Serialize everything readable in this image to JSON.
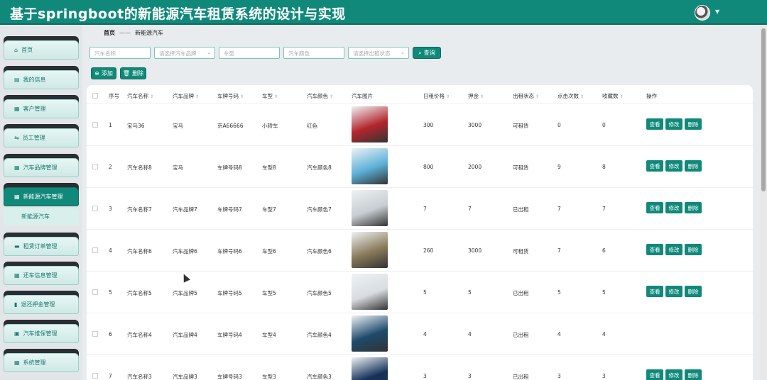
{
  "header": {
    "title": "基于springboot的新能源汽车租赁系统的设计与实现"
  },
  "sidebar": {
    "items": [
      {
        "label": "首页",
        "icon": "home-icon"
      },
      {
        "label": "我的信息",
        "icon": "calendar-icon"
      },
      {
        "label": "客户管理",
        "icon": "grid-icon"
      },
      {
        "label": "员工管理",
        "icon": "sliders-icon"
      },
      {
        "label": "汽车品牌管理",
        "icon": "grid-icon"
      },
      {
        "label": "新能源汽车管理",
        "icon": "grid-icon",
        "active": true
      },
      {
        "label": "租赁订单管理",
        "icon": "monitor-icon"
      },
      {
        "label": "还车信息管理",
        "icon": "grid-icon"
      },
      {
        "label": "退还押金管理",
        "icon": "bar-chart-icon"
      },
      {
        "label": "汽车维保管理",
        "icon": "clipboard-icon"
      },
      {
        "label": "系统管理",
        "icon": "grid-icon"
      }
    ],
    "submenu": "新能源汽车"
  },
  "breadcrumb": {
    "home": "首页",
    "sep": "——",
    "current": "新能源汽车"
  },
  "search": {
    "car_name": "汽车名称",
    "brand": "请选择汽车品牌",
    "model": "车型",
    "color": "汽车颜色",
    "status": "请选择出租状态",
    "query": "查询"
  },
  "toolbar": {
    "add": "添加",
    "delete": "删除"
  },
  "table": {
    "headers": [
      "序号",
      "汽车名称",
      "汽车品牌",
      "车牌号码",
      "车型",
      "汽车颜色",
      "汽车图片",
      "日租价格",
      "押金",
      "出租状态",
      "点击次数",
      "收藏数",
      "操作"
    ],
    "rows": [
      {
        "no": "1",
        "name": "宝马36",
        "brand": "宝马",
        "plate": "京A66666",
        "model": "小轿车",
        "color": "红色",
        "price": "300",
        "deposit": "3000",
        "status": "可租赁",
        "clicks": "0",
        "favs": "0",
        "imgcolor": "#b3262c",
        "actions": true
      },
      {
        "no": "2",
        "name": "汽车名称8",
        "brand": "宝马",
        "plate": "车牌号码8",
        "model": "车型8",
        "color": "汽车颜色8",
        "price": "800",
        "deposit": "2000",
        "status": "可租赁",
        "clicks": "9",
        "favs": "8",
        "imgcolor": "#5bb0d8",
        "actions": true
      },
      {
        "no": "3",
        "name": "汽车名称7",
        "brand": "汽车品牌7",
        "plate": "车牌号码7",
        "model": "车型7",
        "color": "汽车颜色7",
        "price": "7",
        "deposit": "7",
        "status": "已出租",
        "clicks": "7",
        "favs": "7",
        "imgcolor": "#c7cdd2",
        "actions": true
      },
      {
        "no": "4",
        "name": "汽车名称6",
        "brand": "汽车品牌6",
        "plate": "车牌号码6",
        "model": "车型6",
        "color": "汽车颜色6",
        "price": "260",
        "deposit": "3000",
        "status": "可租赁",
        "clicks": "7",
        "favs": "6",
        "imgcolor": "#8a7a5a",
        "actions": true
      },
      {
        "no": "5",
        "name": "汽车名称5",
        "brand": "汽车品牌5",
        "plate": "车牌号码5",
        "model": "车型5",
        "color": "汽车颜色5",
        "price": "5",
        "deposit": "5",
        "status": "已出租",
        "clicks": "5",
        "favs": "5",
        "imgcolor": "#d9dce0",
        "actions": true
      },
      {
        "no": "6",
        "name": "汽车名称4",
        "brand": "汽车品牌4",
        "plate": "车牌号码4",
        "model": "车型4",
        "color": "汽车颜色4",
        "price": "4",
        "deposit": "4",
        "status": "已出租",
        "clicks": "4",
        "favs": "4",
        "imgcolor": "#1d4a6b",
        "actions": false
      },
      {
        "no": "7",
        "name": "汽车名称3",
        "brand": "汽车品牌3",
        "plate": "车牌号码3",
        "model": "车型3",
        "color": "汽车颜色3",
        "price": "3",
        "deposit": "3",
        "status": "已出租",
        "clicks": "3",
        "favs": "3",
        "imgcolor": "#15305a",
        "actions": true
      }
    ],
    "actions": {
      "view": "查看",
      "edit": "修改",
      "delete": "删除"
    }
  },
  "colors": {
    "accent": "#11897a"
  }
}
